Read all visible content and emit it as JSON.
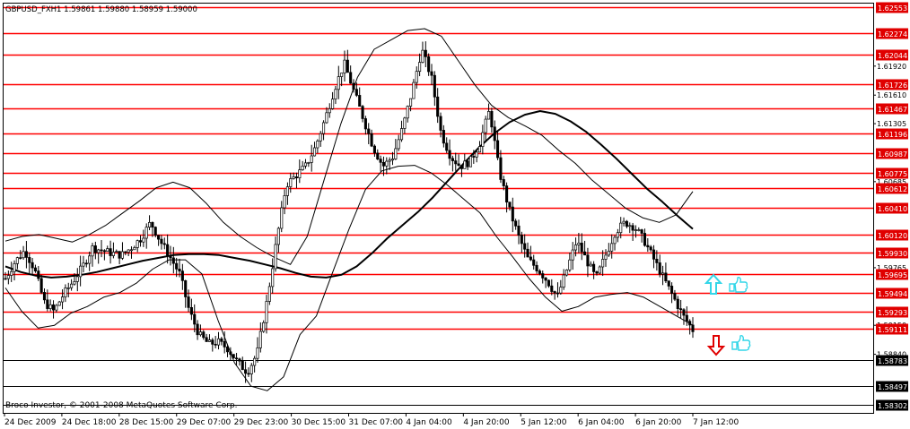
{
  "header": {
    "symbol_line": "GBPUSD_FXH1  1.59861 1.59880 1.58959 1.59000"
  },
  "footer": {
    "copyright": "Broco Investor, © 2001-2008 MetaQuotes Software Corp."
  },
  "colors": {
    "background": "#ffffff",
    "grid_line": "#000000",
    "level_line": "#ff0000",
    "candle": "#000000",
    "indicator": "#000000",
    "label_fill_red": "#e00000",
    "arrow_up": "#33d6e8",
    "arrow_down": "#e00000",
    "thumb": "#33d6e8"
  },
  "icons": {
    "up_signal": "up-arrow-icon",
    "down_signal": "down-arrow-icon",
    "signal_hand": "thumbs-up-icon"
  },
  "chart_data": {
    "type": "candlestick",
    "title": "",
    "xlabel": "",
    "ylabel": "",
    "ylim": [
      1.583,
      1.6255
    ],
    "x_ticks": [
      "24 Dec 2009",
      "24 Dec 18:00",
      "28 Dec 15:00",
      "29 Dec 07:00",
      "29 Dec 23:00",
      "30 Dec 15:00",
      "31 Dec 07:00",
      "4 Jan 04:00",
      "4 Jan 20:00",
      "5 Jan 12:00",
      "6 Jan 04:00",
      "6 Jan 20:00",
      "7 Jan 12:00"
    ],
    "price_axis_ticks": [
      "1.61920",
      "1.61610",
      "1.61305",
      "1.60685",
      "1.59765",
      "1.59150",
      "1.58840"
    ],
    "levels": [
      "1.62553",
      "1.62274",
      "1.62044",
      "1.61726",
      "1.61467",
      "1.61196",
      "1.60987",
      "1.60775",
      "1.60612",
      "1.60410",
      "1.60120",
      "1.59930",
      "1.59695",
      "1.59494",
      "1.59293",
      "1.59111",
      "1.58783",
      "1.58497",
      "1.58302"
    ],
    "price_path": [
      1.5965,
      1.5983,
      1.5995,
      1.5975,
      1.594,
      1.593,
      1.5948,
      1.5962,
      1.5978,
      1.5998,
      1.5995,
      1.5992,
      1.599,
      1.5998,
      1.6008,
      1.6025,
      1.6005,
      1.5988,
      1.597,
      1.593,
      1.5905,
      1.5895,
      1.5897,
      1.589,
      1.5875,
      1.5865,
      1.5885,
      1.594,
      1.6005,
      1.6065,
      1.6075,
      1.6085,
      1.6105,
      1.6135,
      1.6168,
      1.6195,
      1.6165,
      1.6135,
      1.6105,
      1.6085,
      1.6095,
      1.6125,
      1.6165,
      1.621,
      1.618,
      1.612,
      1.6095,
      1.6085,
      1.609,
      1.611,
      1.6145,
      1.608,
      1.604,
      1.601,
      1.5985,
      1.5975,
      1.5962,
      1.5945,
      1.5975,
      1.6005,
      1.5985,
      1.5965,
      1.599,
      1.6015,
      1.6025,
      1.602,
      1.6005,
      1.5985,
      1.5965,
      1.5945,
      1.5925,
      1.591
    ],
    "series": [
      {
        "values": [
          1.5978,
          1.5972,
          1.5968,
          1.5966,
          1.5967,
          1.5969,
          1.5972,
          1.5976,
          1.598,
          1.5984,
          1.5987,
          1.599,
          1.5991,
          1.5991,
          1.599,
          1.5987,
          1.5984,
          1.598,
          1.5976,
          1.5971,
          1.5967,
          1.5966,
          1.5969,
          1.5978,
          1.5992,
          1.6008,
          1.6022,
          1.6036,
          1.6052,
          1.607,
          1.6088,
          1.6105,
          1.612,
          1.6132,
          1.614,
          1.6144,
          1.6141,
          1.6133,
          1.6122,
          1.6108,
          1.6093,
          1.6077,
          1.6061,
          1.6047,
          1.6032,
          1.6018
        ]
      },
      {
        "values": [
          1.6005,
          1.601,
          1.6012,
          1.6008,
          1.6004,
          1.6012,
          1.6022,
          1.6035,
          1.6048,
          1.6062,
          1.6068,
          1.6062,
          1.6045,
          1.6025,
          1.601,
          1.5998,
          1.5988,
          1.598,
          1.601,
          1.607,
          1.613,
          1.618,
          1.621,
          1.622,
          1.623,
          1.6232,
          1.6224,
          1.6198,
          1.6172,
          1.615,
          1.6137,
          1.6128,
          1.6118,
          1.6102,
          1.6088,
          1.607,
          1.6055,
          1.604,
          1.603,
          1.6025,
          1.6033,
          1.6058
        ]
      },
      {
        "values": [
          1.5955,
          1.593,
          1.5912,
          1.5915,
          1.5928,
          1.5935,
          1.5945,
          1.595,
          1.596,
          1.5975,
          1.5985,
          1.5985,
          1.597,
          1.592,
          1.5875,
          1.585,
          1.5845,
          1.586,
          1.5905,
          1.5925,
          1.5972,
          1.6018,
          1.606,
          1.608,
          1.6085,
          1.6086,
          1.6078,
          1.6065,
          1.605,
          1.6035,
          1.601,
          1.5988,
          1.5965,
          1.5945,
          1.593,
          1.5935,
          1.5945,
          1.5948,
          1.595,
          1.5945,
          1.5935,
          1.5925,
          1.5915
        ]
      }
    ]
  }
}
